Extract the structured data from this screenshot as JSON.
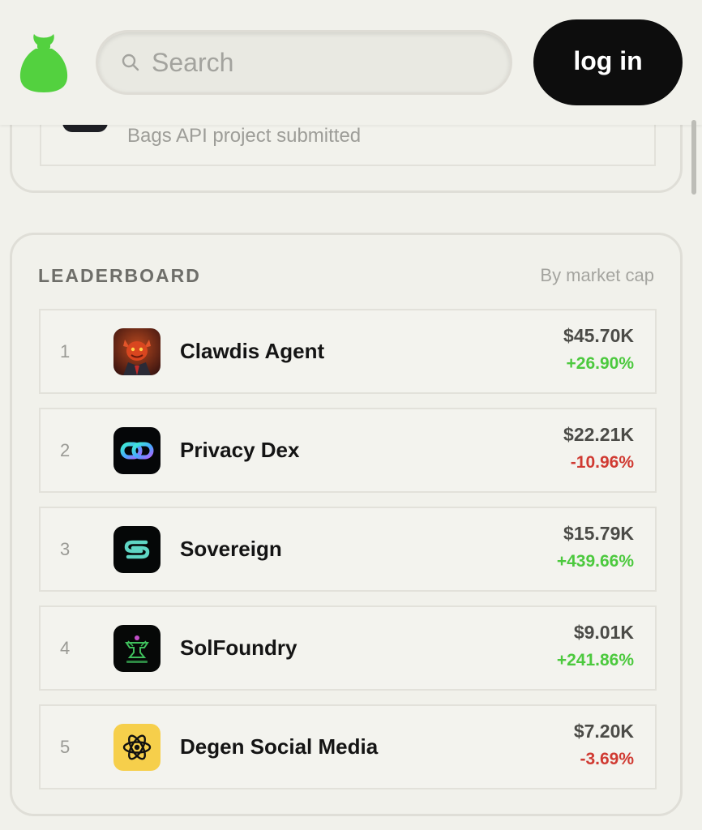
{
  "header": {
    "search": {
      "placeholder": "Search",
      "value": ""
    },
    "login_label": "log in"
  },
  "previous_card": {
    "subtitle": "Bags API project submitted"
  },
  "leaderboard": {
    "title": "LEADERBOARD",
    "sort_label": "By market cap",
    "rows": [
      {
        "rank": "1",
        "name": "Clawdis Agent",
        "price": "$45.70K",
        "change": "+26.90%",
        "direction": "up",
        "icon": "red-dragon-avatar-icon"
      },
      {
        "rank": "2",
        "name": "Privacy Dex",
        "price": "$22.21K",
        "change": "-10.96%",
        "direction": "down",
        "icon": "chain-link-icon"
      },
      {
        "rank": "3",
        "name": "Sovereign",
        "price": "$15.79K",
        "change": "+439.66%",
        "direction": "up",
        "icon": "sovereign-s-icon"
      },
      {
        "rank": "4",
        "name": "SolFoundry",
        "price": "$9.01K",
        "change": "+241.86%",
        "direction": "up",
        "icon": "anvil-icon"
      },
      {
        "rank": "5",
        "name": "Degen Social Media",
        "price": "$7.20K",
        "change": "-3.69%",
        "direction": "down",
        "icon": "atom-icon"
      }
    ]
  },
  "colors": {
    "brand_green": "#53d13f",
    "positive": "#4cc93e",
    "negative": "#d03a32",
    "login_bg": "#0d0d0d"
  }
}
